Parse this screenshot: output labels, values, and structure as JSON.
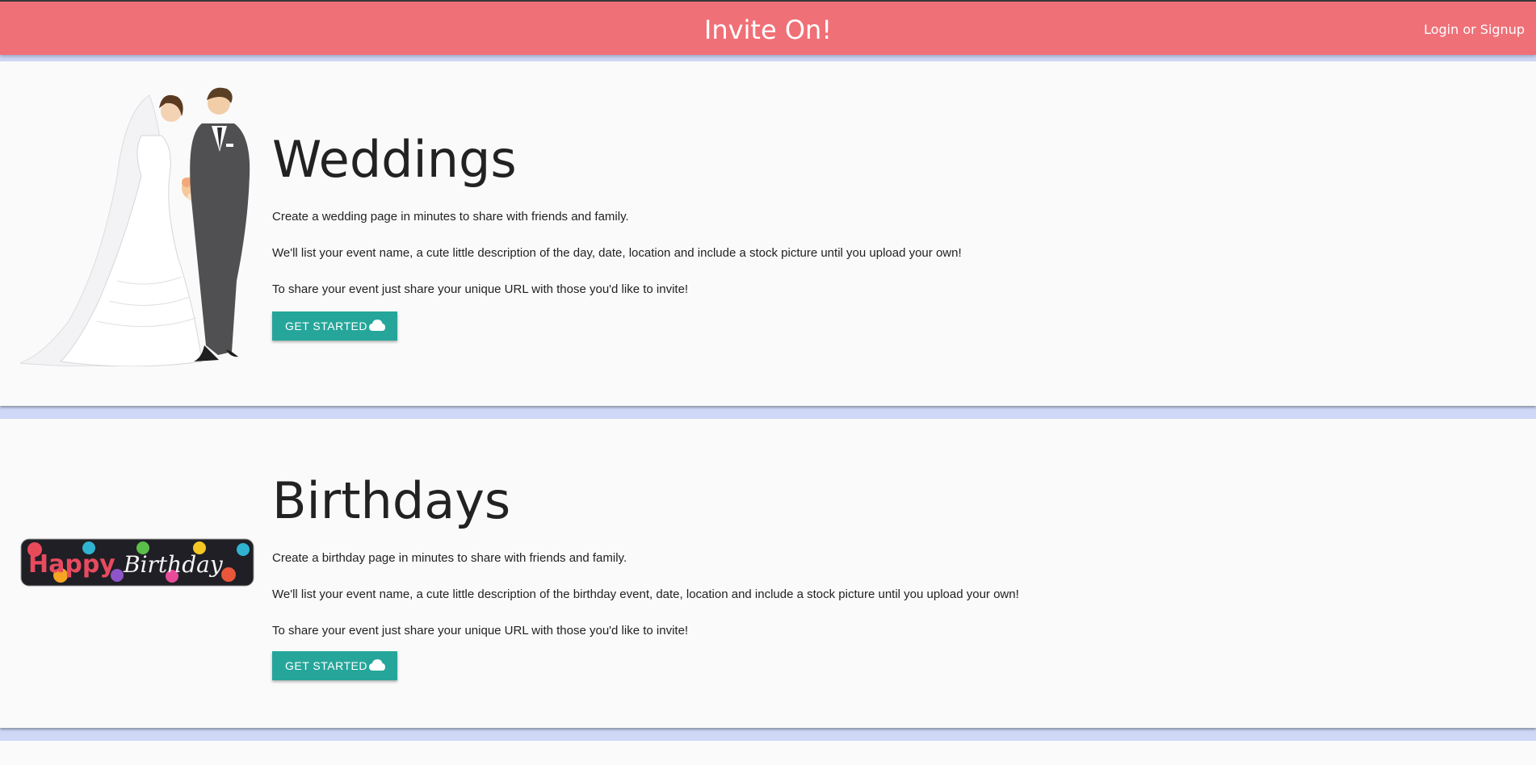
{
  "header": {
    "brand": "Invite On!",
    "login_link": "Login or Signup"
  },
  "sections": [
    {
      "title": "Weddings",
      "paragraphs": [
        "Create a wedding page in minutes to share with friends and family.",
        "We'll list your event name, a cute little description of the day, date, location and include a stock picture until you upload your own!",
        "To share your event just share your unique URL with those you'd like to invite!"
      ],
      "button_label": "GET STARTED",
      "button_icon": "cloud-icon",
      "image": "wedding-couple-illustration"
    },
    {
      "title": "Birthdays",
      "paragraphs": [
        "Create a birthday page in minutes to share with friends and family.",
        "We'll list your event name, a cute little description of the birthday event, date, location and include a stock picture until you upload your own!",
        "To share your event just share your unique URL with those you'd like to invite!"
      ],
      "button_label": "GET STARTED",
      "button_icon": "cloud-icon",
      "image": "happy-birthday-banner",
      "banner_text": [
        "Happy",
        "Birthday"
      ]
    }
  ],
  "colors": {
    "navbar": "#f07077",
    "button": "#26a69a",
    "background": "#cfd8f7",
    "card": "#fafafa"
  }
}
